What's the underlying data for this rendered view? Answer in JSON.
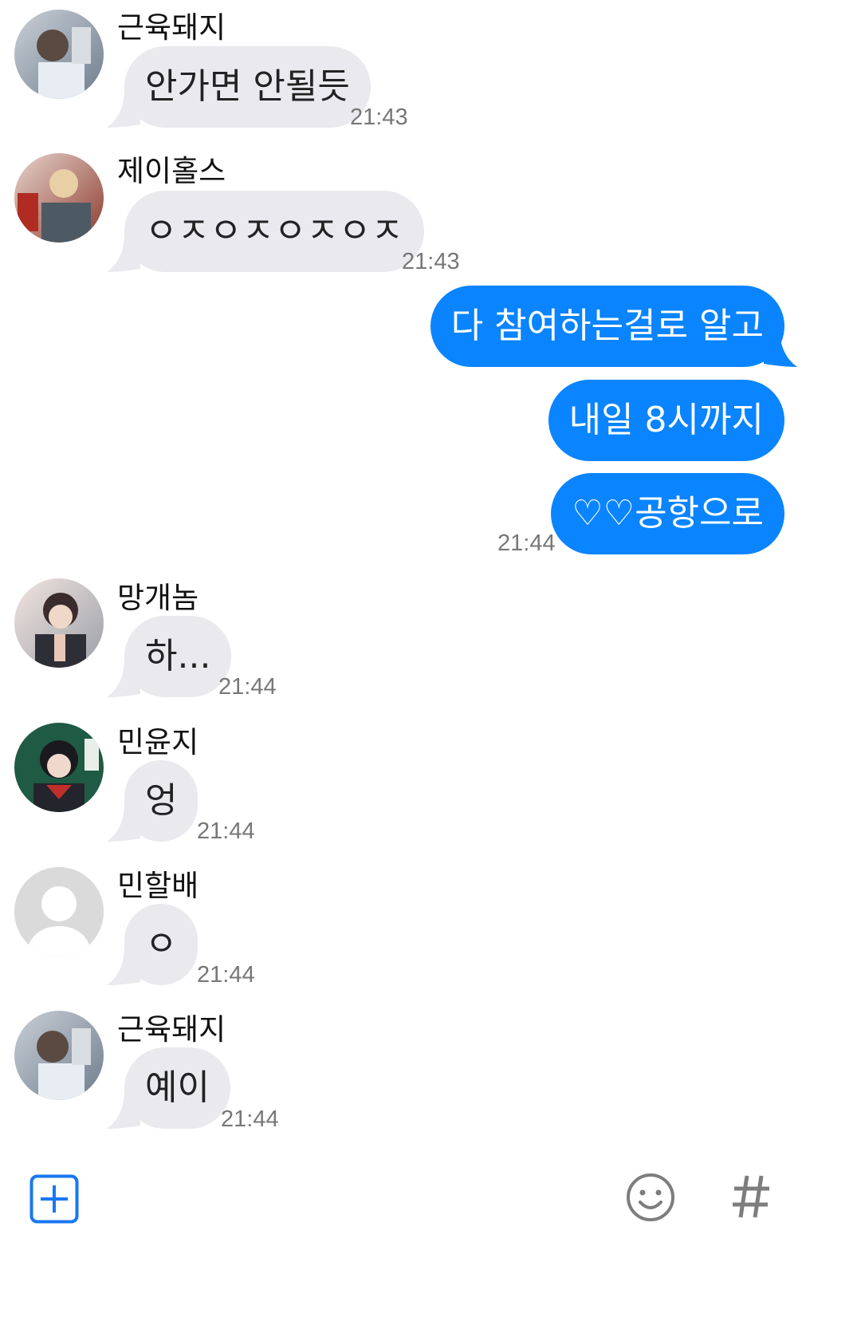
{
  "messages": [
    {
      "sender": "근육돼지",
      "text": "안가면 안될듯",
      "time": "21:43"
    },
    {
      "sender": "제이홀스",
      "text": "ㅇㅈㅇㅈㅇㅈㅇㅈ",
      "time": "21:43"
    },
    {
      "text": "다 참여하는걸로 알고"
    },
    {
      "text": "내일 8시까지"
    },
    {
      "text": "♡♡공항으로",
      "time": "21:44"
    },
    {
      "sender": "망개놈",
      "text": "하...",
      "time": "21:44"
    },
    {
      "sender": "민윤지",
      "text": "엉",
      "time": "21:44"
    },
    {
      "sender": "민할배",
      "text": "ㅇ",
      "time": "21:44"
    },
    {
      "sender": "근육돼지",
      "text": "예이",
      "time": "21:44"
    }
  ],
  "avatars": {
    "a1": "photo-avatar",
    "a2": "photo-avatar",
    "a3": "photo-avatar",
    "a4": "photo-avatar",
    "a5": "default-person-avatar",
    "a6": "photo-avatar"
  },
  "colors": {
    "outgoing": "#0a84ff",
    "incoming": "#e9e9ee",
    "accent": "#1877f2"
  },
  "toolbar": {
    "add_icon": "plus-square-icon",
    "emoji_icon": "smiley-icon",
    "hash_icon": "hashtag-icon"
  }
}
